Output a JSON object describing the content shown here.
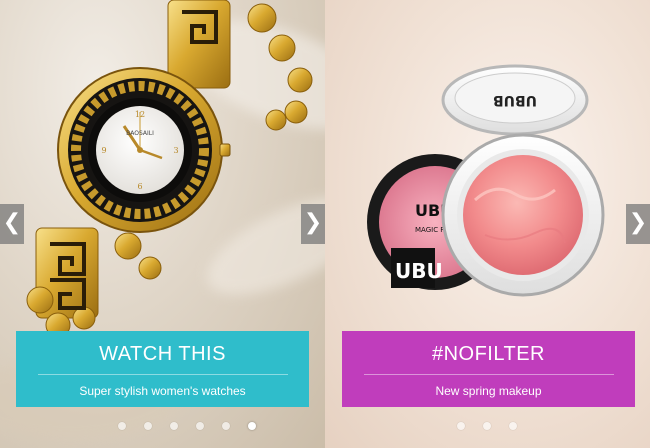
{
  "slides": [
    {
      "title": "WATCH THIS",
      "subtitle": "Super stylish women's watches",
      "banner_color": "#2fbdcb",
      "image_icon": "gold-watch-image",
      "watch_brand": "BAOSAILI",
      "active_dot": 5
    },
    {
      "title": "#NOFILTER",
      "subtitle": "New spring makeup",
      "banner_color": "#c03dbc",
      "image_icon": "blush-compact-image",
      "compact_lid_text": "UBUB",
      "compact_back_text": "UBU",
      "compact_label": "MAGIC ROAST",
      "active_dot": null
    }
  ],
  "nav": {
    "prev_glyph": "❮",
    "next_glyph": "❯"
  }
}
